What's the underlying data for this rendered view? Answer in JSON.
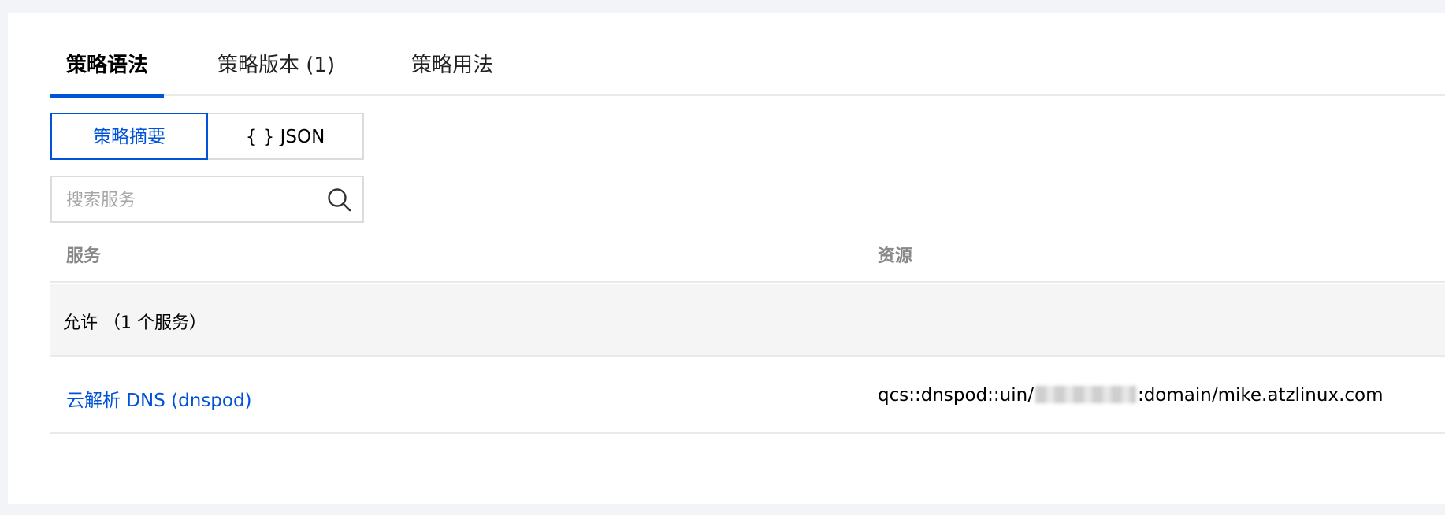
{
  "tabs": [
    {
      "label": "策略语法",
      "active": true
    },
    {
      "label": "策略版本 (1)",
      "active": false
    },
    {
      "label": "策略用法",
      "active": false
    }
  ],
  "view_toggle": {
    "summary_label": "策略摘要",
    "json_label": "{ } JSON",
    "selected": "summary"
  },
  "search": {
    "placeholder": "搜索服务",
    "icon": "search-icon"
  },
  "table": {
    "headers": {
      "service": "服务",
      "resource": "资源"
    },
    "group": {
      "label": "允许 （1 个服务）"
    },
    "rows": [
      {
        "service": "云解析 DNS (dnspod)",
        "resource_prefix": "qcs::dnspod::uin/",
        "resource_suffix": ":domain/mike.atzlinux.com"
      }
    ]
  },
  "colors": {
    "accent": "#0052d9",
    "header_text": "#888888",
    "group_bg": "#f5f5f5"
  }
}
